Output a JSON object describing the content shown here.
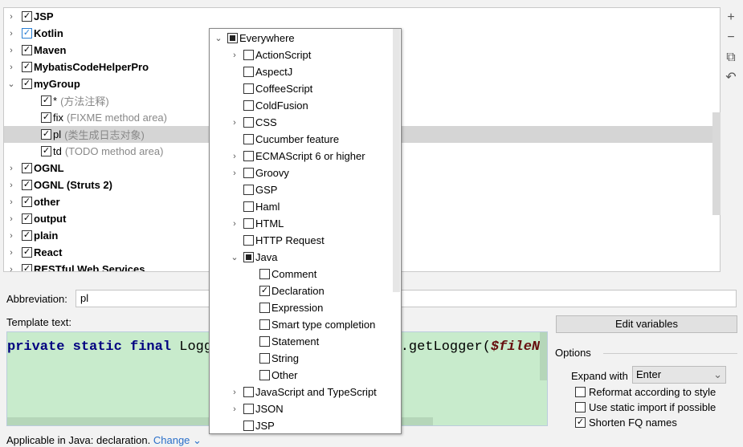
{
  "tree": [
    {
      "label": "JSP",
      "checked": true,
      "bold": true,
      "expanded": false
    },
    {
      "label": "Kotlin",
      "checked": true,
      "bold": true,
      "expanded": false,
      "focused": true
    },
    {
      "label": "Maven",
      "checked": true,
      "bold": true,
      "expanded": false
    },
    {
      "label": "MybatisCodeHelperPro",
      "checked": true,
      "bold": true,
      "expanded": false
    },
    {
      "label": "myGroup",
      "checked": true,
      "bold": true,
      "expanded": true
    },
    {
      "label": "*",
      "desc": "(方法注释)",
      "checked": true,
      "child": true
    },
    {
      "label": "fix",
      "desc": "(FIXME method area)",
      "checked": true,
      "child": true
    },
    {
      "label": "pl",
      "desc": "(类生成日志对象)",
      "checked": true,
      "child": true,
      "selected": true
    },
    {
      "label": "td",
      "desc": "(TODO method area)",
      "checked": true,
      "child": true
    },
    {
      "label": "OGNL",
      "checked": true,
      "bold": true,
      "expanded": false
    },
    {
      "label": "OGNL (Struts 2)",
      "checked": true,
      "bold": true,
      "expanded": false
    },
    {
      "label": "other",
      "checked": true,
      "bold": true,
      "expanded": false
    },
    {
      "label": "output",
      "checked": true,
      "bold": true,
      "expanded": false
    },
    {
      "label": "plain",
      "checked": true,
      "bold": true,
      "expanded": false
    },
    {
      "label": "React",
      "checked": true,
      "bold": true,
      "expanded": false
    },
    {
      "label": "RESTful Web Services",
      "checked": true,
      "bold": true,
      "expanded": false
    }
  ],
  "toolbar": {
    "add": "+",
    "remove": "−",
    "copy": "⧉",
    "revert": "↶"
  },
  "popup": [
    {
      "label": "Everywhere",
      "state": "partial",
      "level": 0,
      "arrow": "down"
    },
    {
      "label": "ActionScript",
      "state": "off",
      "level": 1,
      "arrow": "right"
    },
    {
      "label": "AspectJ",
      "state": "off",
      "level": 1
    },
    {
      "label": "CoffeeScript",
      "state": "off",
      "level": 1
    },
    {
      "label": "ColdFusion",
      "state": "off",
      "level": 1
    },
    {
      "label": "CSS",
      "state": "off",
      "level": 1,
      "arrow": "right"
    },
    {
      "label": "Cucumber feature",
      "state": "off",
      "level": 1
    },
    {
      "label": "ECMAScript 6 or higher",
      "state": "off",
      "level": 1,
      "arrow": "right"
    },
    {
      "label": "Groovy",
      "state": "off",
      "level": 1,
      "arrow": "right"
    },
    {
      "label": "GSP",
      "state": "off",
      "level": 1
    },
    {
      "label": "Haml",
      "state": "off",
      "level": 1
    },
    {
      "label": "HTML",
      "state": "off",
      "level": 1,
      "arrow": "right"
    },
    {
      "label": "HTTP Request",
      "state": "off",
      "level": 1
    },
    {
      "label": "Java",
      "state": "partial",
      "level": 1,
      "arrow": "down"
    },
    {
      "label": "Comment",
      "state": "off",
      "level": 2
    },
    {
      "label": "Declaration",
      "state": "on",
      "level": 2
    },
    {
      "label": "Expression",
      "state": "off",
      "level": 2
    },
    {
      "label": "Smart type completion",
      "state": "off",
      "level": 2
    },
    {
      "label": "Statement",
      "state": "off",
      "level": 2
    },
    {
      "label": "String",
      "state": "off",
      "level": 2
    },
    {
      "label": "Other",
      "state": "off",
      "level": 2
    },
    {
      "label": "JavaScript and TypeScript",
      "state": "off",
      "level": 1,
      "arrow": "right"
    },
    {
      "label": "JSON",
      "state": "off",
      "level": 1,
      "arrow": "right"
    },
    {
      "label": "JSP",
      "state": "off",
      "level": 1
    }
  ],
  "abbreviation": {
    "label": "Abbreviation:",
    "value": "pl"
  },
  "template": {
    "label": "Template text:",
    "kw": "private static final ",
    "mid": "Logg",
    "hidden_gap": "                      ",
    "tail": "y.getLogger(",
    "var": "$fileN"
  },
  "edit_variables": "Edit variables",
  "options": {
    "label": "Options",
    "expand_label": "Expand with",
    "expand_value": "Enter",
    "checks": [
      {
        "label": "Reformat according to style",
        "checked": false
      },
      {
        "label": "Use static import if possible",
        "checked": false
      },
      {
        "label": "Shorten FQ names",
        "checked": true
      }
    ]
  },
  "applicable": {
    "text": "Applicable in Java: declaration.",
    "change": "Change"
  }
}
